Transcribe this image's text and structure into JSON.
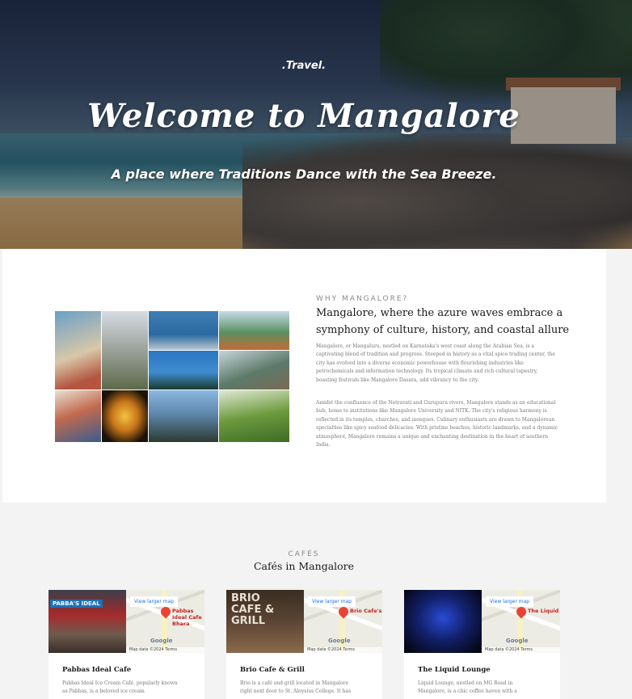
{
  "hero": {
    "brand": ".Travel.",
    "title": "Welcome to Mangalore",
    "tagline": "A place where Traditions Dance with the Sea Breeze."
  },
  "about": {
    "eyebrow": "WHY MANGALORE?",
    "heading": "Mangalore, where the azure waves embrace a symphony of culture, history, and coastal allure",
    "paragraph1": "Mangalore, or Mangaluru, nestled on Karnataka's west coast along the Arabian Sea, is a captivating blend of tradition and progress. Steeped in history as a vital spice trading center, the city has evolved into a diverse economic powerhouse with flourishing industries like petrochemicals and information technology. Its tropical climate and rich cultural tapestry, boasting festivals like Mangalore Dasara, add vibrancy to the city.",
    "paragraph2": "Amidst the confluence of the Netravati and Gurupura rivers, Mangalore stands as an educational hub, home to institutions like Mangalore University and NITK. The city's religious harmony is reflected in its temples, churches, and mosques. Culinary enthusiasts are drawn to Mangalorean specialties like spicy seafood delicacies. With pristine beaches, historic landmarks, and a dynamic atmosphere, Mangalore remains a unique and enchanting destination in the heart of southern India."
  },
  "cafes": {
    "eyebrow": "CAFÉS",
    "title": "Cafés in Mangalore",
    "map_link": "View larger map",
    "map_data": "Map data ©2024   Terms",
    "google": "Google",
    "items": [
      {
        "name": "Pabbas Ideal Cafe",
        "photo_logo": "PABBA'S IDEAL",
        "pin_label": "Pabbas Ideal Cafe Bhara",
        "description": "Pabbas Ideal Ice Cream Café, popularly known as Pabbas, is a beloved ice cream"
      },
      {
        "name": "Brio Cafe & Grill",
        "photo_logo": "BRIO CAFE & GRILL",
        "pin_label": "Brio Cafe's",
        "description": "Brio is a café and grill located in Mangalore right next door to St. Aloysius College. It has"
      },
      {
        "name": "The Liquid Lounge",
        "photo_logo": "",
        "pin_label": "The Liquid",
        "description": "Liquid Lounge, nestled on MG Road in Mangalore, is a chic coffee haven with a"
      }
    ]
  }
}
